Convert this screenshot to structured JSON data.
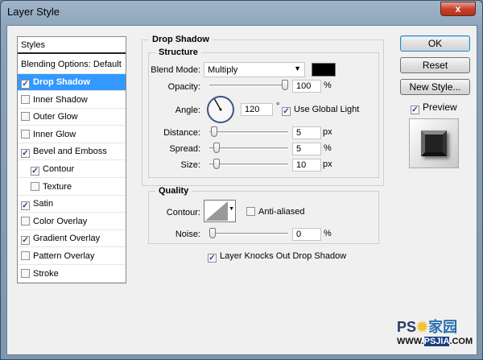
{
  "window": {
    "title": "Layer Style",
    "close_glyph": "x"
  },
  "styles_panel": {
    "header": "Styles",
    "blending_options": "Blending Options: Default",
    "items": [
      {
        "label": "Drop Shadow",
        "checked": true,
        "selected": true,
        "indent": false
      },
      {
        "label": "Inner Shadow",
        "checked": false,
        "indent": false
      },
      {
        "label": "Outer Glow",
        "checked": false,
        "indent": false
      },
      {
        "label": "Inner Glow",
        "checked": false,
        "indent": false
      },
      {
        "label": "Bevel and Emboss",
        "checked": true,
        "indent": false
      },
      {
        "label": "Contour",
        "checked": true,
        "indent": true
      },
      {
        "label": "Texture",
        "checked": false,
        "indent": true
      },
      {
        "label": "Satin",
        "checked": true,
        "indent": false
      },
      {
        "label": "Color Overlay",
        "checked": false,
        "indent": false
      },
      {
        "label": "Gradient Overlay",
        "checked": true,
        "indent": false
      },
      {
        "label": "Pattern Overlay",
        "checked": false,
        "indent": false
      },
      {
        "label": "Stroke",
        "checked": false,
        "indent": false
      }
    ]
  },
  "drop_shadow": {
    "title": "Drop Shadow",
    "structure": {
      "title": "Structure",
      "blend_mode_label": "Blend Mode:",
      "blend_mode_value": "Multiply",
      "shadow_color": "#000000",
      "opacity_label": "Opacity:",
      "opacity_value": "100",
      "opacity_unit": "%",
      "opacity_slider": 100,
      "angle_label": "Angle:",
      "angle_value": "120",
      "angle_unit": "°",
      "use_global_light": "Use Global Light",
      "use_global_light_checked": true,
      "distance_label": "Distance:",
      "distance_value": "5",
      "distance_unit": "px",
      "distance_slider": 2,
      "spread_label": "Spread:",
      "spread_value": "5",
      "spread_unit": "%",
      "spread_slider": 5,
      "size_label": "Size:",
      "size_value": "10",
      "size_unit": "px",
      "size_slider": 5
    },
    "quality": {
      "title": "Quality",
      "contour_label": "Contour:",
      "anti_aliased": "Anti-aliased",
      "anti_aliased_checked": false,
      "noise_label": "Noise:",
      "noise_value": "0",
      "noise_unit": "%",
      "noise_slider": 0
    },
    "knocks_out": "Layer Knocks Out Drop Shadow",
    "knocks_out_checked": true
  },
  "buttons": {
    "ok": "OK",
    "reset": "Reset",
    "new_style": "New Style...",
    "preview": "Preview",
    "preview_checked": true
  },
  "watermark": {
    "text": "PS家园 WWW.PSJIA.COM"
  }
}
